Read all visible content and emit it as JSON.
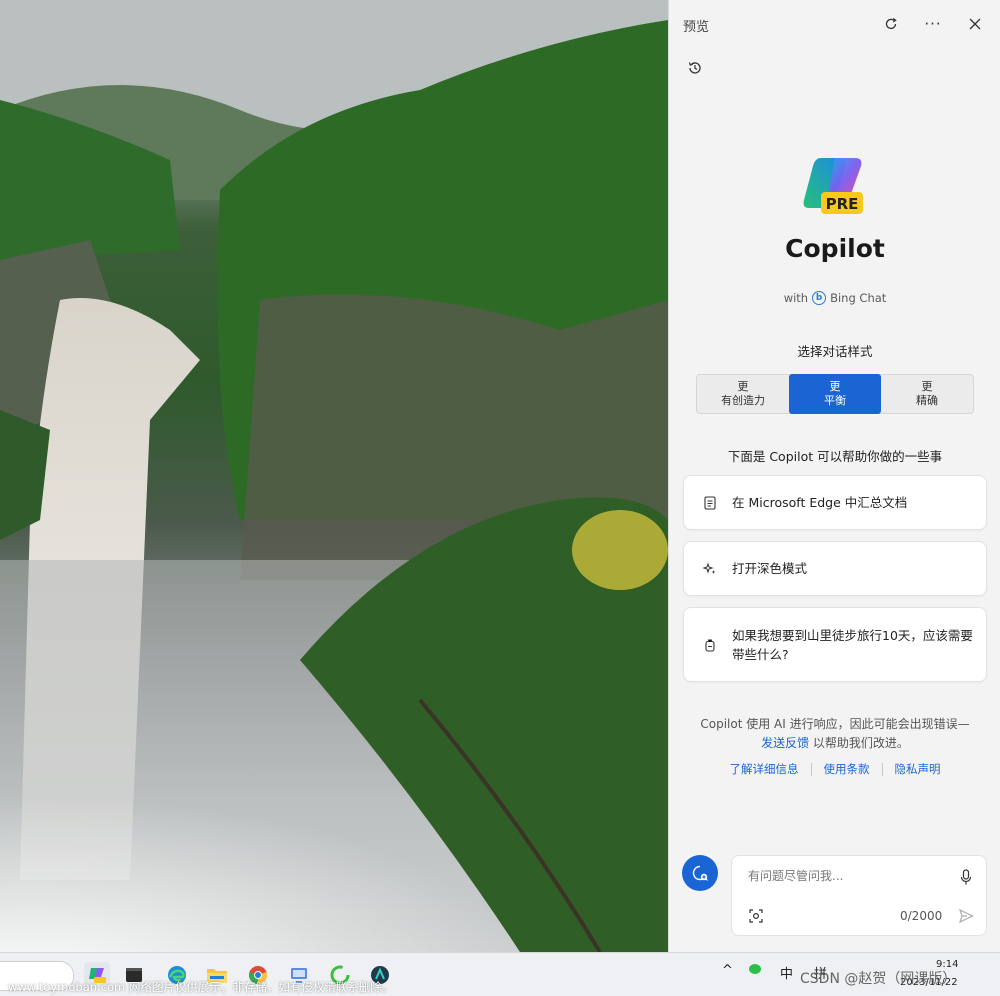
{
  "pane": {
    "title": "预览",
    "brand": "Copilot",
    "logo_badge": "PRE",
    "subtitle_with": "with",
    "subtitle_product": "Bing Chat",
    "style_label": "选择对话样式",
    "styles": [
      {
        "line1": "更",
        "line2": "有创造力"
      },
      {
        "line1": "更",
        "line2": "平衡"
      },
      {
        "line1": "更",
        "line2": "精确"
      }
    ],
    "active_style_index": 1,
    "help_title": "下面是 Copilot 可以帮助你做的一些事",
    "suggestions": [
      {
        "icon": "document-icon",
        "text": "在 Microsoft Edge 中汇总文档"
      },
      {
        "icon": "sparkle-icon",
        "text": "打开深色模式"
      },
      {
        "icon": "backpack-icon",
        "text": "如果我想要到山里徒步旅行10天，应该需要带些什么?"
      }
    ],
    "disclaimer_line1": "Copilot 使用 AI 进行响应，因此可能会出现错误—",
    "disclaimer_link": "发送反馈",
    "disclaimer_line2": "以帮助我们改进。",
    "footer_links": [
      "了解详细信息",
      "使用条款",
      "隐私声明"
    ],
    "composer": {
      "placeholder": "有问题尽管问我...",
      "char_count": "0/2000"
    }
  },
  "taskbar": {
    "tray_ime": "中",
    "tray_pinyin": "拼",
    "clock_time": "9:14",
    "clock_date": "2023/11/22"
  },
  "watermark": "www.toymoban.com 网络图片仅供展示，非存储，如有侵权请联系删除。",
  "watermark2": "CSDN @赵贺（网课版）",
  "colors": {
    "accent": "#1a64d4",
    "pane_bg": "#f3f3f3"
  }
}
